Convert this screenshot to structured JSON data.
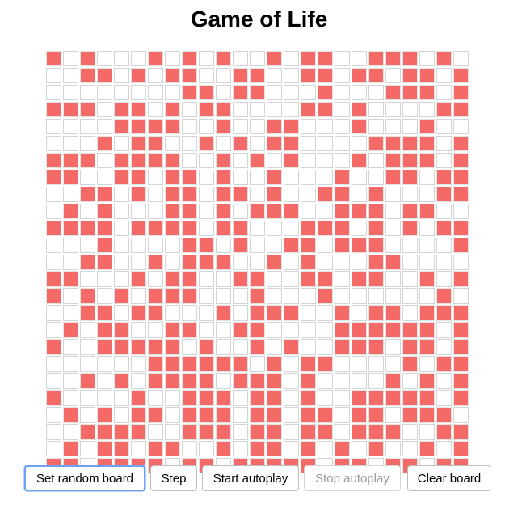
{
  "title": "Game of Life",
  "board": {
    "rows": 25,
    "cols": 25,
    "alive_color": "#f46a66",
    "dead_color": "#ffffff",
    "grid": [
      "1010001010100101100111010",
      "0011010110011001101101101",
      "0000000011011000100011101",
      "1110110101100001101000011",
      "0000111100100110001000100",
      "0001011001010110000111101",
      "1110111100101010001011101",
      "1100110110100100010011011",
      "0011010110110100110100011",
      "0101000110101110011101100",
      "1111011110110001110101011",
      "0001000011010011011100001",
      "0011001011100101000110000",
      "1100010110011001101100101",
      "1010101110001000100000010",
      "0011011000101110010110111",
      "0101100110011000011111101",
      "1001111101001010011101101",
      "0000001111110101100001011",
      "0010101111011101000010101",
      "1000010011101101001111101",
      "0101011011101101101101110",
      "0011110011101101101110011",
      "0101101100101101010100101",
      "1101111011011111011011011"
    ]
  },
  "controls": {
    "random_label": "Set random board",
    "step_label": "Step",
    "start_label": "Start autoplay",
    "stop_label": "Stop autoplay",
    "clear_label": "Clear board"
  }
}
